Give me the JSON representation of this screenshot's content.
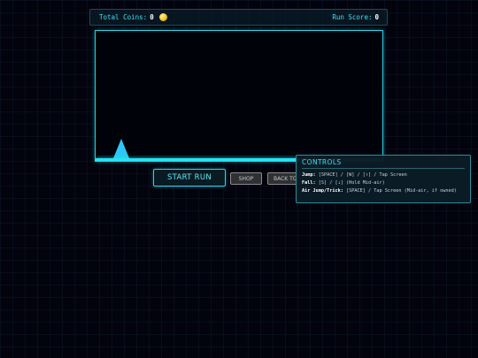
{
  "hud": {
    "total_coins_label": "Total Coins:",
    "total_coins_value": "0",
    "run_score_label": "Run Score:",
    "run_score_value": "0"
  },
  "buttons": {
    "start_run": "START RUN",
    "shop": "SHOP",
    "back": "BACK TO"
  },
  "controls": {
    "title": "CONTROLS",
    "rows": [
      {
        "key": "Jump:",
        "value": "[SPACE] / [W] / [↑] / Tap Screen"
      },
      {
        "key": "Fall:",
        "value": "[S] / [↓] (Hold Mid-air)"
      },
      {
        "key": "Air Jump/Trick:",
        "value": "[SPACE] / Tap Screen (Mid-air, if owned)"
      }
    ]
  },
  "colors": {
    "accent": "#26e3f2",
    "player": "#2cc8f5",
    "coin": "#f2c21b",
    "background": "#02030d"
  }
}
